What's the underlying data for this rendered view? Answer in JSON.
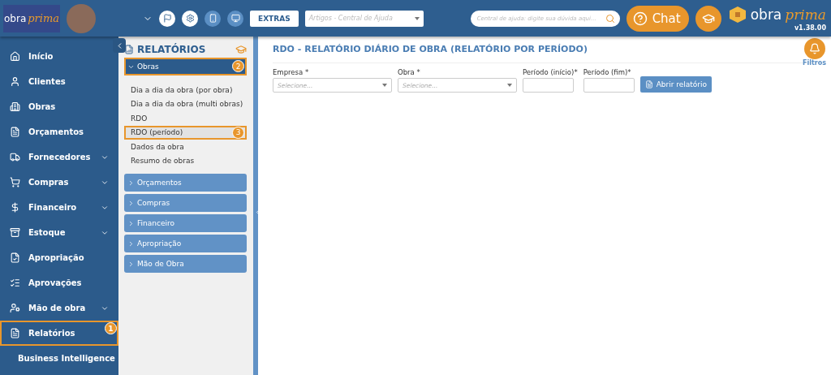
{
  "header": {
    "logo": {
      "word": "obra",
      "script": "prima"
    },
    "extras_button": "EXTRAS",
    "articles_select": {
      "placeholder": "Artigos - Central de Ajuda"
    },
    "help_search": {
      "placeholder": "Central de ajuda: digite sua dúvida aqui..."
    },
    "chat_button": "Chat",
    "brand": {
      "word": "obra",
      "script": "prima"
    },
    "version": "v1.38.00"
  },
  "sidebar": {
    "items": [
      {
        "label": "Início",
        "expandable": false
      },
      {
        "label": "Clientes",
        "expandable": false
      },
      {
        "label": "Obras",
        "expandable": false
      },
      {
        "label": "Orçamentos",
        "expandable": false
      },
      {
        "label": "Fornecedores",
        "expandable": true
      },
      {
        "label": "Compras",
        "expandable": true
      },
      {
        "label": "Financeiro",
        "expandable": true
      },
      {
        "label": "Estoque",
        "expandable": true
      },
      {
        "label": "Apropriação",
        "expandable": false
      },
      {
        "label": "Aprovações",
        "expandable": false
      },
      {
        "label": "Mão de obra",
        "expandable": true
      },
      {
        "label": "Relatórios",
        "expandable": false,
        "badge": "1"
      },
      {
        "label": "Business Intelligence",
        "expandable": false
      }
    ]
  },
  "reports_panel": {
    "title": "RELATÓRIOS",
    "groups": [
      {
        "label": "Obras",
        "expanded": true,
        "badge": "2",
        "children": [
          {
            "label": "Dia a dia da obra (por obra)",
            "selected": false
          },
          {
            "label": "Dia a dia da obra (multi obras)",
            "selected": false
          },
          {
            "label": "RDO",
            "selected": false
          },
          {
            "label": "RDO (período)",
            "selected": true,
            "badge": "3"
          },
          {
            "label": "Dados da obra",
            "selected": false
          },
          {
            "label": "Resumo de obras",
            "selected": false
          }
        ]
      },
      {
        "label": "Orçamentos",
        "expanded": false
      },
      {
        "label": "Compras",
        "expanded": false
      },
      {
        "label": "Financeiro",
        "expanded": false
      },
      {
        "label": "Apropriação",
        "expanded": false
      },
      {
        "label": "Mão de Obra",
        "expanded": false
      }
    ]
  },
  "main": {
    "title": "RDO - RELATÓRIO DIÁRIO DE OBRA (RELATÓRIO POR PERÍODO)",
    "filters_label": "Filtros",
    "fields": [
      {
        "label": "Empresa *",
        "kind": "select",
        "placeholder": "Selecione..."
      },
      {
        "label": "Obra *",
        "kind": "select",
        "placeholder": "Selecione..."
      },
      {
        "label": "Período (início)*",
        "kind": "date"
      },
      {
        "label": "Período (fim)*",
        "kind": "date"
      }
    ],
    "open_button": "Abrir relatório"
  }
}
